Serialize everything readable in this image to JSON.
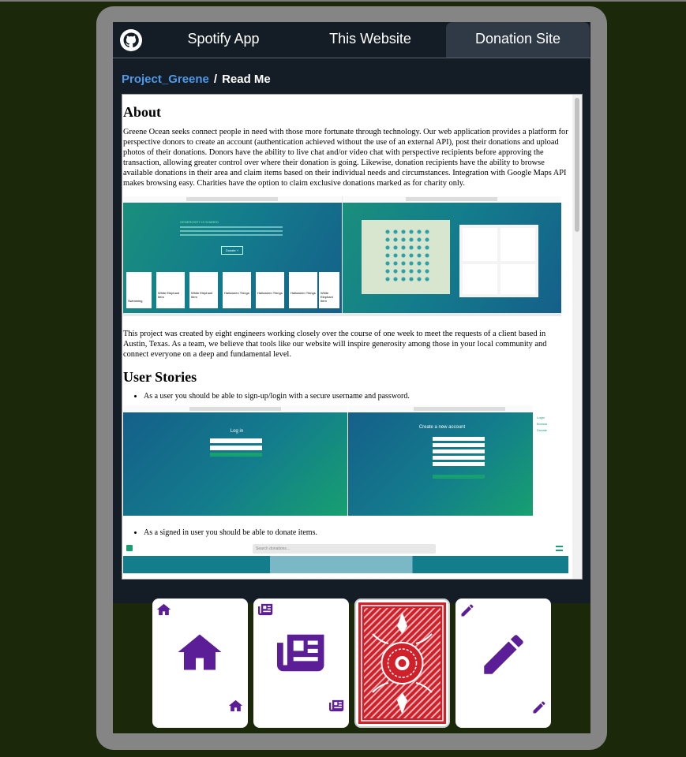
{
  "nav": {
    "tabs": [
      {
        "label": "Spotify App",
        "active": false
      },
      {
        "label": "This Website",
        "active": false
      },
      {
        "label": "Donation Site",
        "active": true
      }
    ]
  },
  "breadcrumb": {
    "repo": "Project_Greene",
    "separator": "/",
    "file": "Read Me"
  },
  "readme": {
    "about_heading": "About",
    "about_text": "Greene Ocean seeks connect people in need with those more fortunate through technology. Our web application provides a platform for perspective donors to create an account (authentication achieved without the use of an external API), post their donations and upload photos of their donations. Donors have the ability to live chat and/or video chat with perspective recipients before approving the transaction, allowing greater control over where their donation is going. Likewise, donation recipients have the ability to browse available donations in their area and claim items based on their individual needs and circumstances. Integration with Google Maps API makes browsing easy. Charities have the option to claim exclusive donations marked as for charity only.",
    "project_text": "This project was created by eight engineers working closely over the course of one week to meet the requests of a client based in Austin, Texas. As a team, we believe that tools like our website will inspire generosity among those in your local community and connect everyone on a deep and fundamental level.",
    "stories_heading": "User Stories",
    "story_1": "As a user you should be able to sign-up/login with a secure username and password.",
    "story_2": "As a signed in user you should be able to donate items.",
    "shot1": {
      "tagline": "GENEROSITY IS SHARED",
      "donate_button": "Donate +",
      "items": [
        "Swimming",
        "White Elephant Item",
        "White Elephant Item",
        "Halloween Things",
        "Halloween Things",
        "Halloween Things",
        "White Elephant Item"
      ]
    },
    "shot2": {
      "login_title": "Log in",
      "signup_title": "Create a new account",
      "menu_items": [
        "Login",
        "Browse",
        "Donate"
      ]
    },
    "shot3": {
      "search_placeholder": "Search donations..."
    }
  },
  "cards": [
    {
      "name": "home",
      "icon": "home-icon"
    },
    {
      "name": "newspaper",
      "icon": "newspaper-icon"
    },
    {
      "name": "card-back",
      "icon": "card-back-pattern"
    },
    {
      "name": "pencil",
      "icon": "pencil-icon"
    }
  ],
  "colors": {
    "accent": "#5b1e96",
    "link": "#4e9ae8",
    "teal": "#137d8c",
    "card_back_red": "#d0202a"
  }
}
